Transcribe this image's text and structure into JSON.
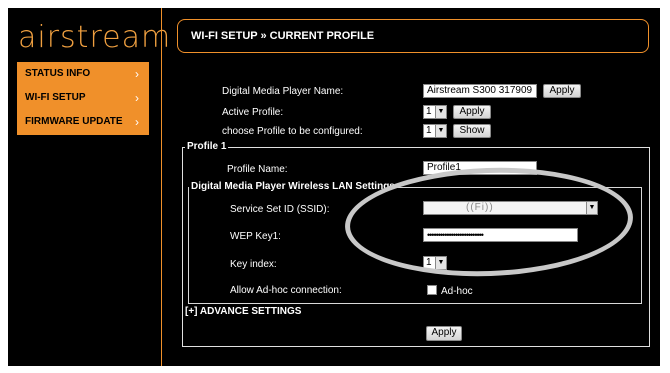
{
  "brand": {
    "logo_text": "airstream",
    "accent_color": "#f0902a"
  },
  "nav": {
    "items": [
      {
        "label": "STATUS INFO"
      },
      {
        "label": "WI-FI SETUP"
      },
      {
        "label": "FIRMWARE UPDATE"
      }
    ],
    "chevron_icon": "chevron-right-icon"
  },
  "header": {
    "title": "WI-FI SETUP » CURRENT PROFILE"
  },
  "form": {
    "player_name": {
      "label": "Digital Media Player Name:",
      "value": "Airstream S300 317909",
      "button": "Apply"
    },
    "active_profile": {
      "label": "Active Profile:",
      "value": "1",
      "button": "Apply"
    },
    "configure_profile": {
      "label": "choose Profile to be configured:",
      "value": "1",
      "button": "Show"
    }
  },
  "profile": {
    "legend": "Profile 1",
    "name_label": "Profile Name:",
    "name_value": "Profile1",
    "wlan": {
      "legend": "Digital Media Player Wireless LAN Settings",
      "ssid_label": "Service Set ID (SSID):",
      "ssid_value": "((Fi))",
      "wep_label": "WEP Key1:",
      "wep_value": "••••••••••••••••••••••••••",
      "key_index_label": "Key index:",
      "key_index_value": "1",
      "adhoc_label": "Allow Ad-hoc connection:",
      "adhoc_checkbox_label": "Ad-hoc",
      "adhoc_checked": false
    },
    "advance_settings": "[+] ADVANCE SETTINGS",
    "apply_button": "Apply"
  }
}
